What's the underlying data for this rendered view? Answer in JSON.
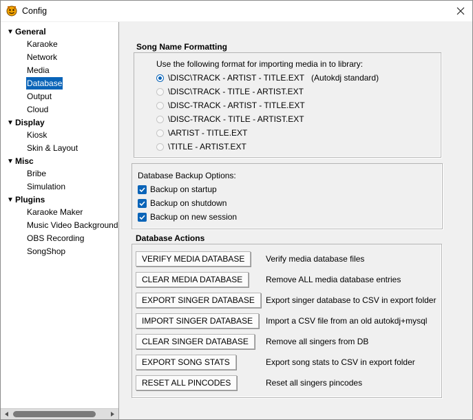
{
  "window": {
    "title": "Config",
    "app_icon": "autokdj-app-icon",
    "close_icon": "close-icon"
  },
  "sidebar": {
    "groups": [
      {
        "label": "General",
        "items": [
          "Karaoke",
          "Network",
          "Media",
          "Database",
          "Output",
          "Cloud"
        ]
      },
      {
        "label": "Display",
        "items": [
          "Kiosk",
          "Skin & Layout"
        ]
      },
      {
        "label": "Misc",
        "items": [
          "Bribe",
          "Simulation"
        ]
      },
      {
        "label": "Plugins",
        "items": [
          "Karaoke Maker",
          "Music Video Background",
          "OBS Recording",
          "SongShop"
        ]
      }
    ],
    "selected": "Database"
  },
  "song_name_formatting": {
    "title": "Song Name Formatting",
    "prompt": "Use the following format for importing media in to library:",
    "options": [
      {
        "label": "\\DISC\\TRACK - ARTIST - TITLE.EXT",
        "note": "(Autokdj standard)",
        "checked": true
      },
      {
        "label": "\\DISC\\TRACK - TITLE - ARTIST.EXT",
        "checked": false
      },
      {
        "label": "\\DISC-TRACK - ARTIST - TITLE.EXT",
        "checked": false
      },
      {
        "label": "\\DISC-TRACK - TITLE - ARTIST.EXT",
        "checked": false
      },
      {
        "label": "\\ARTIST - TITLE.EXT",
        "checked": false
      },
      {
        "label": "\\TITLE - ARTIST.EXT",
        "checked": false
      }
    ]
  },
  "backup": {
    "title": "Database Backup Options:",
    "options": [
      {
        "label": "Backup on startup",
        "checked": true
      },
      {
        "label": "Backup on shutdown",
        "checked": true
      },
      {
        "label": "Backup on new session",
        "checked": true
      }
    ]
  },
  "actions": {
    "title": "Database Actions",
    "items": [
      {
        "button": "VERIFY MEDIA DATABASE",
        "description": "Verify media database files"
      },
      {
        "button": "CLEAR MEDIA DATABASE",
        "description": "Remove ALL media database entries"
      },
      {
        "button": "EXPORT SINGER DATABASE",
        "description": "Export singer database to CSV in export folder"
      },
      {
        "button": "IMPORT SINGER DATABASE",
        "description": "Import a CSV file from an old autokdj+mysql"
      },
      {
        "button": "CLEAR SINGER DATABASE",
        "description": "Remove all singers from DB"
      },
      {
        "button": "EXPORT SONG STATS",
        "description": "Export song stats to CSV in export folder"
      },
      {
        "button": "RESET ALL PINCODES",
        "description": "Reset all singers pincodes"
      }
    ]
  },
  "colors": {
    "accent": "#0a64b8",
    "background": "#f0f0f0"
  }
}
